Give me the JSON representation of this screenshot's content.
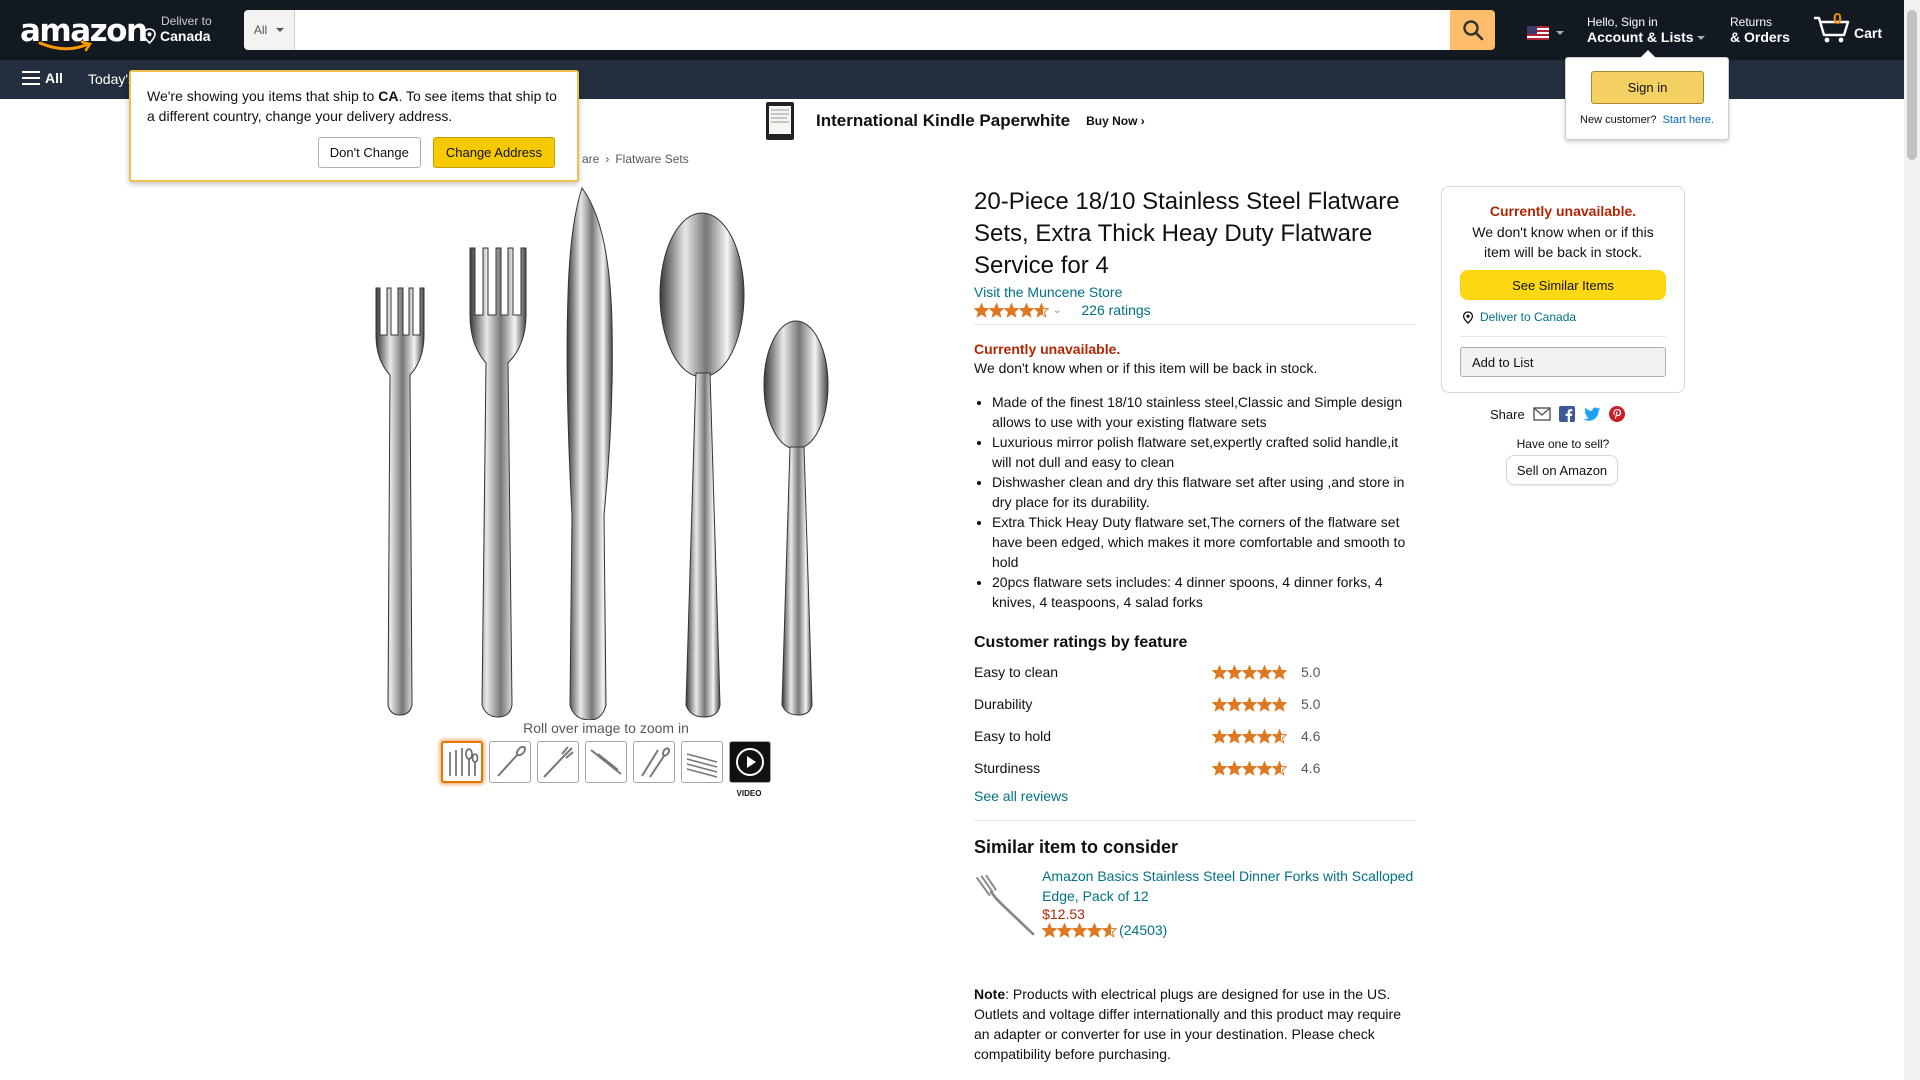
{
  "header": {
    "logo_text": "amazon",
    "deliver_label": "Deliver to",
    "deliver_country": "Canada",
    "search_category": "All",
    "search_placeholder": "",
    "account_greeting": "Hello, Sign in",
    "account_label": "Account & Lists",
    "returns_label": "Returns",
    "orders_label": "& Orders",
    "cart_count": "0",
    "cart_label": "Cart"
  },
  "nav": {
    "all_label": "All",
    "today_label": "Today's"
  },
  "popover": {
    "text_before": "We're showing you items that ship to ",
    "country_code": "CA",
    "text_after": ". To see items that ship to a different country, change your delivery address.",
    "dont_change": "Don't Change",
    "change_address": "Change Address"
  },
  "signin_flyout": {
    "button": "Sign in",
    "new_customer": "New customer?",
    "start_here": "Start here."
  },
  "banner": {
    "title": "International Kindle Paperwhite",
    "cta": "Buy Now ›"
  },
  "breadcrumb": [
    "are",
    "›",
    "Flatware Sets"
  ],
  "gallery": {
    "zoom_hint": "Roll over image to zoom in",
    "video_label": "VIDEO"
  },
  "product": {
    "title": "20-Piece 18/10 Stainless Steel Flatware Sets, Extra Thick Heay Duty Flatware Service for 4",
    "store": "Visit the Muncene Store",
    "rating": 4.6,
    "ratings_count": "226 ratings",
    "unavailable": "Currently unavailable.",
    "unavailable_sub": "We don't know when or if this item will be back in stock.",
    "bullets": [
      "Made of the finest 18/10 stainless steel,Classic and Simple design allows to use with your existing flatware sets",
      "Luxurious mirror polish flatware set,expertly crafted solid handle,it will not dull and easy to clean",
      "Dishwasher clean and dry this flatware set after using ,and store in dry place for its durability.",
      "Extra Thick Heay Duty flatware set,The corners of the flatware set have been edged, which makes it more comfortable and smooth to hold",
      "20pcs flatware sets includes: 4 dinner spoons, 4 dinner forks, 4 knives, 4 teaspoons, 4 salad forks"
    ]
  },
  "feature_ratings": {
    "heading": "Customer ratings by feature",
    "items": [
      {
        "name": "Easy to clean",
        "value": "5.0",
        "stars": 5.0
      },
      {
        "name": "Durability",
        "value": "5.0",
        "stars": 5.0
      },
      {
        "name": "Easy to hold",
        "value": "4.6",
        "stars": 4.6
      },
      {
        "name": "Sturdiness",
        "value": "4.6",
        "stars": 4.6
      }
    ],
    "see_all": "See all reviews"
  },
  "similar": {
    "heading": "Similar item to consider",
    "title": "Amazon Basics Stainless Steel Dinner Forks with Scalloped Edge, Pack of 12",
    "price": "$12.53",
    "rating": 4.6,
    "count": "(24503)"
  },
  "note": {
    "label": "Note",
    "text": ": Products with electrical plugs are designed for use in the US. Outlets and voltage differ internationally and this product may require an adapter or converter for use in your destination. Please check compatibility before purchasing."
  },
  "buybox": {
    "unavailable": "Currently unavailable.",
    "unavailable_sub": "We don't know when or if this item will be back in stock.",
    "see_similar": "See Similar Items",
    "deliver": "Deliver to Canada",
    "add_to_list": "Add to List"
  },
  "share": {
    "label": "Share",
    "have_one": "Have one to sell?",
    "sell": "Sell on Amazon"
  },
  "colors": {
    "nav_dark": "#131921",
    "nav_secondary": "#232f3e",
    "star": "#de7921",
    "link": "#007185",
    "unavailable": "#b12704",
    "yellow_button": "#ffd814"
  }
}
